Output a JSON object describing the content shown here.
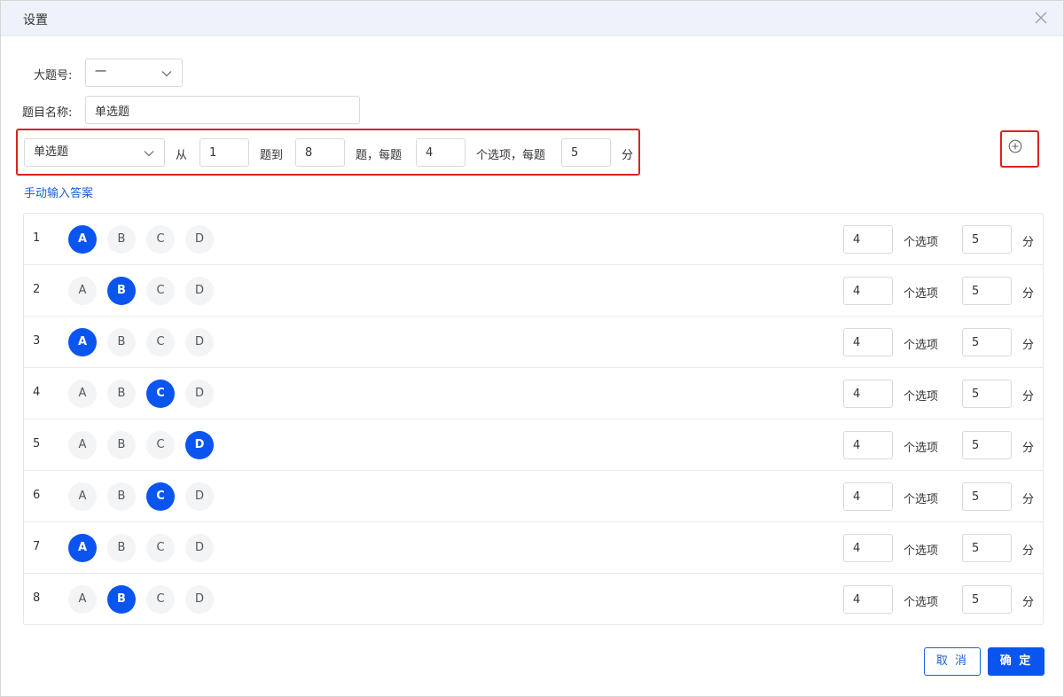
{
  "dialog": {
    "title": "设置",
    "close_icon": "close-icon"
  },
  "form": {
    "section_label": "大题号:",
    "section_value": "一",
    "name_label": "题目名称:",
    "name_value": "单选题"
  },
  "range": {
    "type_value": "单选题",
    "from_label": "从",
    "from_value": "1",
    "to_label": "题到",
    "to_value": "8",
    "each_label": "题，每题",
    "options_value": "4",
    "options_label": "个选项，每题",
    "score_value": "5",
    "score_unit": "分",
    "add_icon": "plus-circle-icon"
  },
  "manual_link": "手动输入答案",
  "option_letters": [
    "A",
    "B",
    "C",
    "D"
  ],
  "row_units": {
    "options": "个选项",
    "score": "分"
  },
  "rows": [
    {
      "num": "1",
      "selected": "A",
      "options": "4",
      "score": "5"
    },
    {
      "num": "2",
      "selected": "B",
      "options": "4",
      "score": "5"
    },
    {
      "num": "3",
      "selected": "A",
      "options": "4",
      "score": "5"
    },
    {
      "num": "4",
      "selected": "C",
      "options": "4",
      "score": "5"
    },
    {
      "num": "5",
      "selected": "D",
      "options": "4",
      "score": "5"
    },
    {
      "num": "6",
      "selected": "C",
      "options": "4",
      "score": "5"
    },
    {
      "num": "7",
      "selected": "A",
      "options": "4",
      "score": "5"
    },
    {
      "num": "8",
      "selected": "B",
      "options": "4",
      "score": "5"
    }
  ],
  "footer": {
    "cancel_label": "取 消",
    "ok_label": "确 定"
  },
  "colors": {
    "accent": "#0a55f0",
    "highlight_border": "#e02020",
    "header_bg": "#eef3fb"
  }
}
